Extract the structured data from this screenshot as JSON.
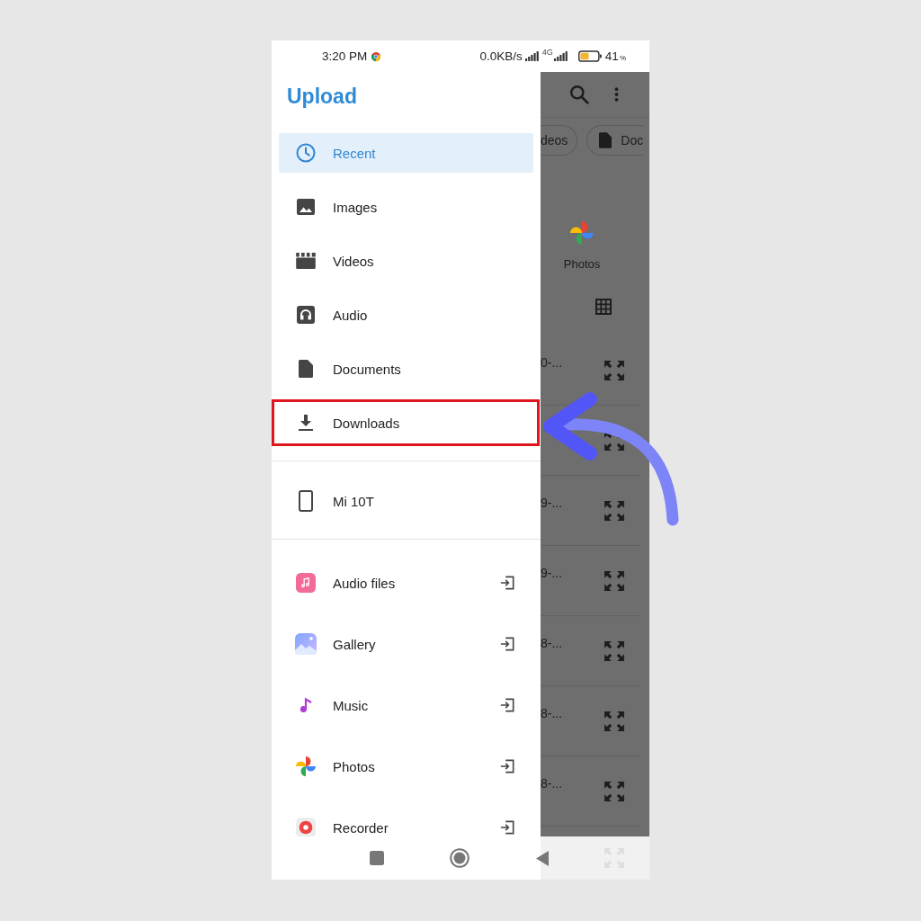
{
  "status_bar": {
    "time": "3:20 PM",
    "data_speed": "0.0KB/s",
    "network_type": "4G",
    "battery": "41",
    "battery_unit": "%"
  },
  "drawer": {
    "title": "Upload",
    "sections": [
      {
        "items": [
          {
            "kind": "category",
            "label": "Recent",
            "selected": true,
            "highlighted": false
          },
          {
            "kind": "category",
            "label": "Images",
            "selected": false,
            "highlighted": false
          },
          {
            "kind": "category",
            "label": "Videos",
            "selected": false,
            "highlighted": false
          },
          {
            "kind": "category",
            "label": "Audio",
            "selected": false,
            "highlighted": false
          },
          {
            "kind": "category",
            "label": "Documents",
            "selected": false,
            "highlighted": false
          },
          {
            "kind": "category",
            "label": "Downloads",
            "selected": false,
            "highlighted": true
          }
        ]
      },
      {
        "items": [
          {
            "kind": "device",
            "label": "Mi 10T",
            "selected": false,
            "highlighted": false
          }
        ]
      },
      {
        "items": [
          {
            "kind": "app",
            "label": "Audio files",
            "selected": false,
            "highlighted": false
          },
          {
            "kind": "app",
            "label": "Gallery",
            "selected": false,
            "highlighted": false
          },
          {
            "kind": "app",
            "label": "Music",
            "selected": false,
            "highlighted": false
          },
          {
            "kind": "app",
            "label": "Photos",
            "selected": false,
            "highlighted": false
          },
          {
            "kind": "app",
            "label": "Recorder",
            "selected": false,
            "highlighted": false
          }
        ]
      }
    ]
  },
  "background_screen": {
    "chips": [
      {
        "label": "deos"
      },
      {
        "label": "Doc"
      }
    ],
    "shortcut": {
      "label": "Photos"
    },
    "files": [
      {
        "kind": "file",
        "name": "0-..."
      },
      {
        "kind": "covered"
      },
      {
        "kind": "file",
        "name": "9-..."
      },
      {
        "kind": "file",
        "name": "9-..."
      },
      {
        "kind": "file",
        "name": "8-..."
      },
      {
        "kind": "file",
        "name": "8-..."
      },
      {
        "kind": "file",
        "name": "8-..."
      }
    ]
  }
}
